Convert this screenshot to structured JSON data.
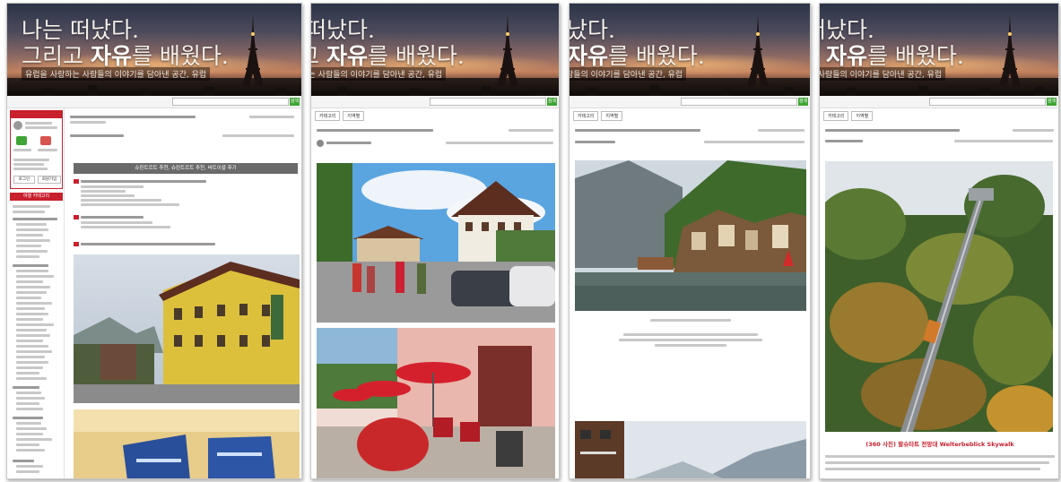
{
  "banner": {
    "line1": "나는 떠났다.",
    "line2_pre": "그리고 ",
    "line2_bold": "자유",
    "line2_post": "를 배웠다.",
    "subtitle": "유럽을 사랑하는 사람들의 이야기를 담아낸 공간, 유럽"
  },
  "nav": {
    "tab1": "카테고리",
    "tab2": "지역별",
    "go_button": "검색"
  },
  "sidebar": {
    "login_label": "로그인",
    "signup_label": "회원가입",
    "category_header": "여행 카테고리"
  },
  "post1": {
    "section_title": "슈린트르트 추천, 슈린트르트 추천, 바트이셜 후기"
  },
  "post4": {
    "caption": "(360 사진) 할슈타트 전망대 Welterbeblick Skywalk"
  },
  "colors": {
    "accent_red": "#c8202d",
    "go_green": "#3fa535",
    "section_gray": "#6a6a6a"
  }
}
